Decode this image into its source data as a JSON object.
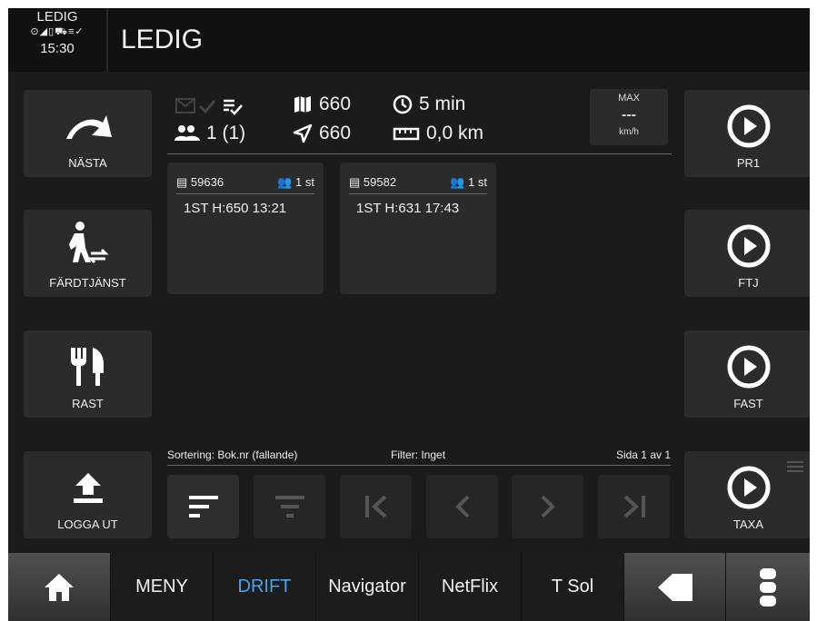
{
  "status": {
    "label": "LEDIG",
    "icons": "⊙◢▯⛟≡✓",
    "time": "15:30"
  },
  "header": {
    "title": "LEDIG"
  },
  "left_buttons": [
    {
      "label": "NÄSTA",
      "icon": "redo-arrow-icon"
    },
    {
      "label": "FÄRDTJÄNST",
      "icon": "walking-transfer-icon"
    },
    {
      "label": "RAST",
      "icon": "restaurant-icon"
    },
    {
      "label": "LOGGA UT",
      "icon": "upload-icon"
    }
  ],
  "right_buttons": [
    {
      "label": "PR1",
      "icon": "play-circle-icon"
    },
    {
      "label": "FTJ",
      "icon": "play-circle-icon"
    },
    {
      "label": "FAST",
      "icon": "play-circle-icon"
    },
    {
      "label": "TAXA",
      "icon": "play-circle-icon"
    }
  ],
  "info": {
    "map_value": "660",
    "time_value": "5 min",
    "passengers": "1 (1)",
    "nav_value": "660",
    "distance": "0,0 km"
  },
  "speed": {
    "label": "MAX",
    "value": "---",
    "unit": "km/h"
  },
  "cards": [
    {
      "id": "59636",
      "count": "1 st",
      "text": "1ST H:650 13:21"
    },
    {
      "id": "59582",
      "count": "1 st",
      "text": "1ST H:631 17:43"
    }
  ],
  "toolbar": {
    "sort_label": "Sortering: Bok.nr (fallande)",
    "filter_label": "Filter: Inget",
    "page_label": "Sida 1 av 1"
  },
  "nav": {
    "home": "home-icon",
    "items": [
      "MENY",
      "DRIFT",
      "Navigator",
      "NetFlix",
      "T Sol"
    ],
    "back": "back-arrow-icon",
    "more": "more-icon"
  },
  "colors": {
    "accent": "#4aa3e8",
    "background": "#1b1b1b",
    "panel": "#2b2b2b"
  }
}
